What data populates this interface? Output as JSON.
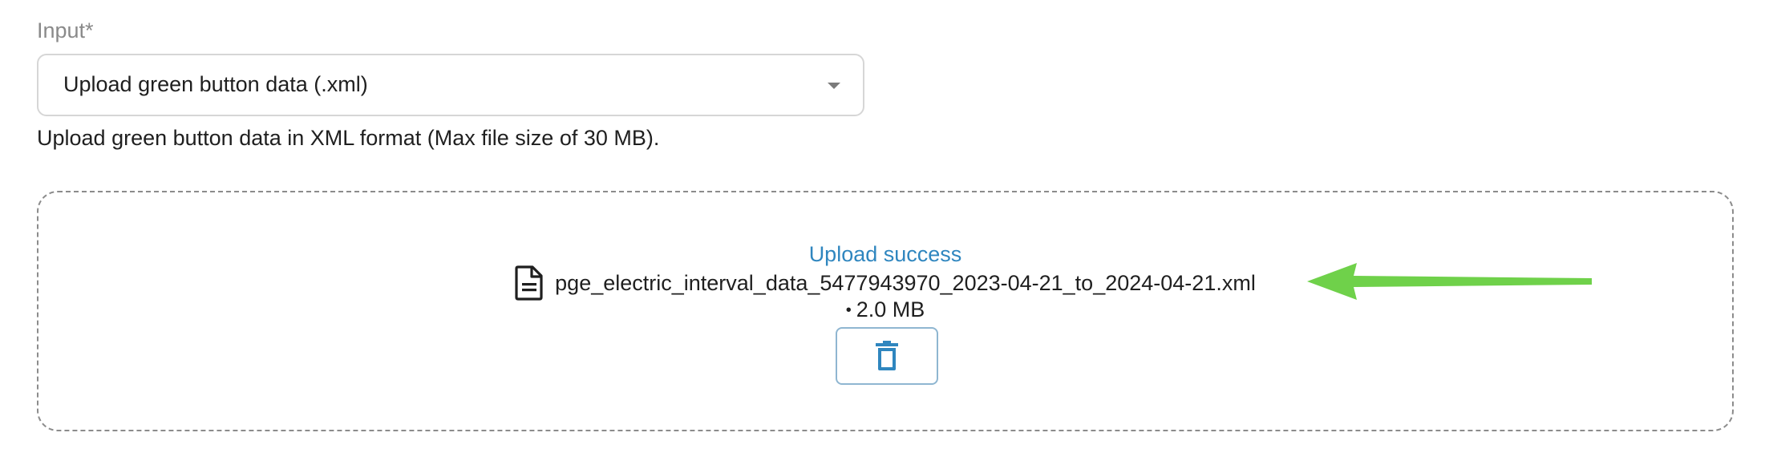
{
  "form": {
    "input_label": "Input*",
    "select_value": "Upload green button data (.xml)",
    "helper_text": "Upload green button data in XML format (Max file size of 30 MB)."
  },
  "upload": {
    "status": "Upload success",
    "file_name": "pge_electric_interval_data_5477943970_2023-04-21_to_2024-04-21.xml",
    "size_separator": "•",
    "file_size": "2.0 MB"
  },
  "icons": {
    "file": "file-text-icon",
    "delete": "trash-icon",
    "caret": "caret-down-icon",
    "annotation": "arrow-left-icon"
  },
  "colors": {
    "accent": "#2f86bf",
    "annotation_arrow": "#6fd14a",
    "border": "#d6d6d6",
    "dashed_border": "#8c8c8c"
  }
}
